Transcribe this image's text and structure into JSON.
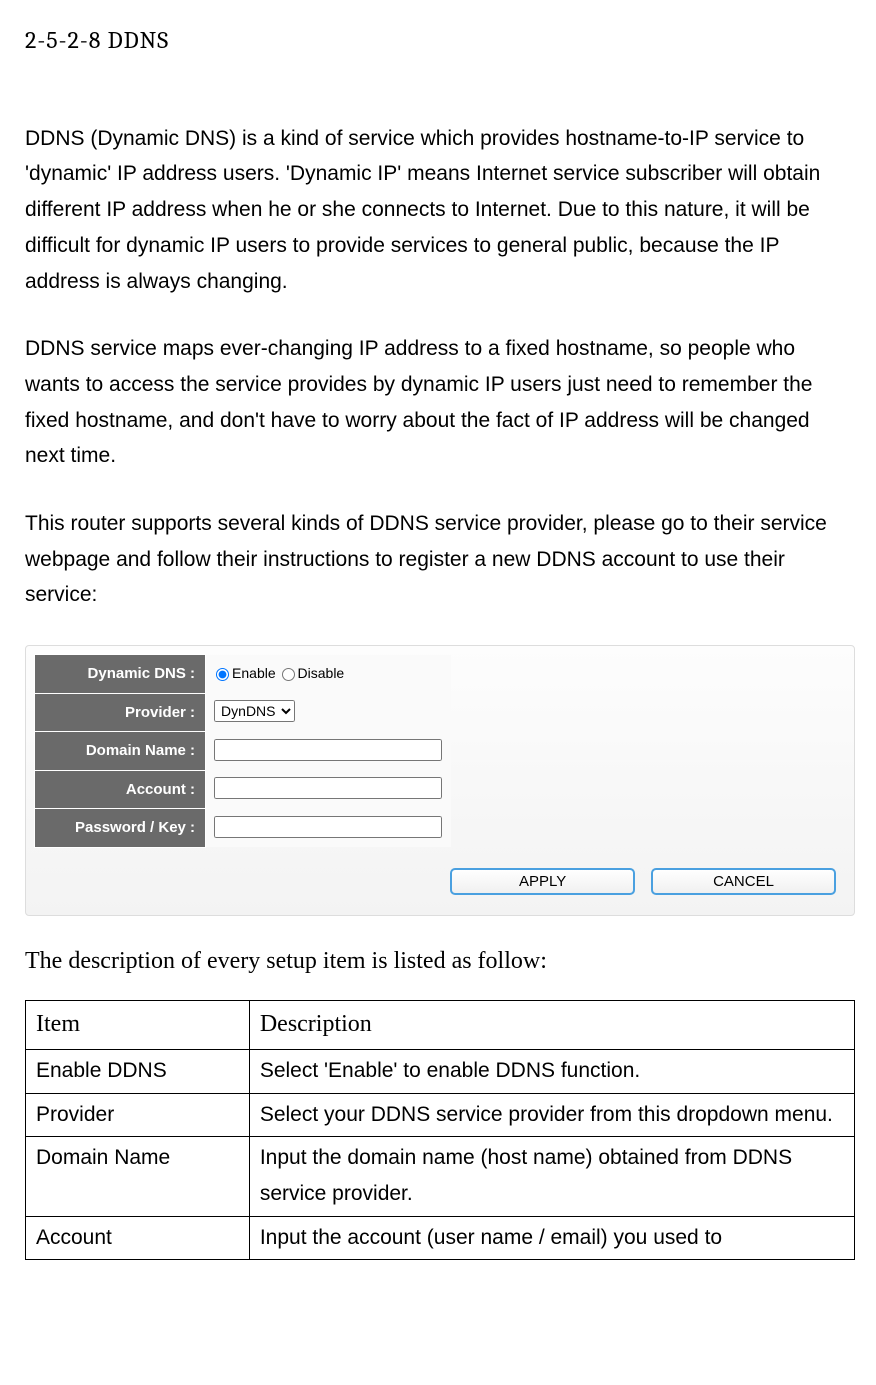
{
  "heading": "2-5-2-8 DDNS",
  "paragraphs": {
    "p1": "DDNS (Dynamic DNS) is a kind of service which provides hostname-to-IP service to 'dynamic' IP address users. 'Dynamic IP' means Internet service subscriber will obtain different IP address when he or she connects to Internet. Due to this nature, it will be difficult for dynamic IP users to provide services to general public, because the IP address is always changing.",
    "p2": "DDNS service maps ever-changing IP address to a fixed hostname, so people who wants to access the service provides by dynamic IP users just need to remember the fixed hostname, and don't have to worry about the fact of IP address will be changed next time.",
    "p3": "This router supports several kinds of DDNS service provider, please go to their service webpage and follow their instructions to register a new DDNS account to use their service:"
  },
  "form": {
    "labels": {
      "dynamic_dns": "Dynamic DNS :",
      "provider": "Provider :",
      "domain_name": "Domain Name :",
      "account": "Account :",
      "password": "Password / Key :"
    },
    "radio": {
      "enable": "Enable",
      "disable": "Disable"
    },
    "provider_selected": "DynDNS",
    "domain_value": "",
    "account_value": "",
    "password_value": "",
    "buttons": {
      "apply": "APPLY",
      "cancel": "CANCEL"
    }
  },
  "caption": "The description of every setup item is listed as follow:",
  "table": {
    "headers": {
      "item": "Item",
      "description": "Description"
    },
    "rows": [
      {
        "item": "Enable DDNS",
        "desc": "Select 'Enable' to enable DDNS function."
      },
      {
        "item": "Provider",
        "desc": "Select your DDNS service provider from this dropdown menu."
      },
      {
        "item": "Domain Name",
        "desc": "Input the domain name (host name) obtained from DDNS service provider."
      },
      {
        "item": "Account",
        "desc": "Input the account (user name / email) you used to"
      }
    ]
  }
}
